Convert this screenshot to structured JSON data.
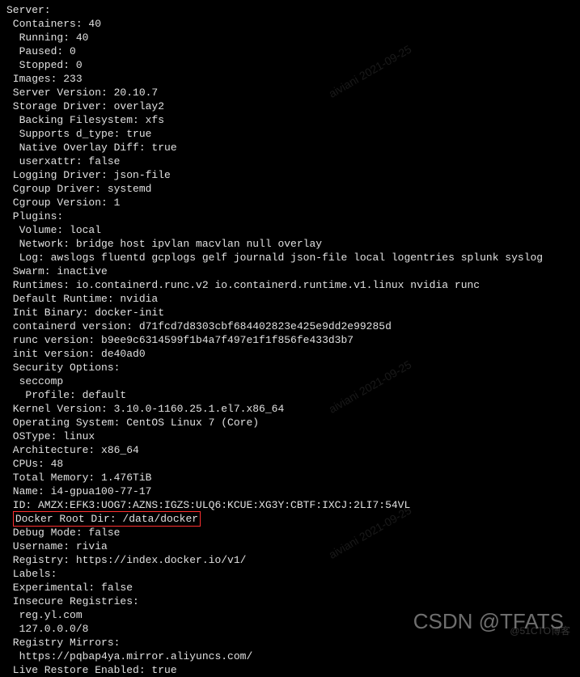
{
  "server_header": "Server:",
  "containers": " Containers: 40",
  "running": "  Running: 40",
  "paused": "  Paused: 0",
  "stopped": "  Stopped: 0",
  "images": " Images: 233",
  "server_version": " Server Version: 20.10.7",
  "storage_driver": " Storage Driver: overlay2",
  "backing_fs": "  Backing Filesystem: xfs",
  "supports_dtype": "  Supports d_type: true",
  "native_overlay": "  Native Overlay Diff: true",
  "userxattr": "  userxattr: false",
  "logging_driver": " Logging Driver: json-file",
  "cgroup_driver": " Cgroup Driver: systemd",
  "cgroup_version": " Cgroup Version: 1",
  "plugins": " Plugins:",
  "volume": "  Volume: local",
  "network": "  Network: bridge host ipvlan macvlan null overlay",
  "log": "  Log: awslogs fluentd gcplogs gelf journald json-file local logentries splunk syslog",
  "swarm": " Swarm: inactive",
  "runtimes": " Runtimes: io.containerd.runc.v2 io.containerd.runtime.v1.linux nvidia runc",
  "default_runtime": " Default Runtime: nvidia",
  "init_binary": " Init Binary: docker-init",
  "containerd_ver": " containerd version: d71fcd7d8303cbf684402823e425e9dd2e99285d",
  "runc_ver": " runc version: b9ee9c6314599f1b4a7f497e1f1f856fe433d3b7",
  "init_ver": " init version: de40ad0",
  "sec_opts": " Security Options:",
  "seccomp": "  seccomp",
  "profile": "   Profile: default",
  "kernel": " Kernel Version: 3.10.0-1160.25.1.el7.x86_64",
  "os": " Operating System: CentOS Linux 7 (Core)",
  "ostype": " OSType: linux",
  "arch": " Architecture: x86_64",
  "cpus": " CPUs: 48",
  "memory": " Total Memory: 1.476TiB",
  "name": " Name: i4-gpua100-77-17",
  "id": " ID: AMZX:EFK3:UOG7:AZNS:IGZS:ULQ6:KCUE:XG3Y:CBTF:IXCJ:2LI7:54VL",
  "docker_root_prefix": " ",
  "docker_root": "Docker Root Dir: /data/docker",
  "debug": " Debug Mode: false",
  "username": " Username: rivia",
  "registry": " Registry: https://index.docker.io/v1/",
  "labels": " Labels:",
  "experimental": " Experimental: false",
  "insecure": " Insecure Registries:",
  "reg1": "  reg.yl.com",
  "reg2": "  127.0.0.0/8",
  "mirrors": " Registry Mirrors:",
  "mirror1": "  https://pqbap4ya.mirror.aliyuncs.com/",
  "live_restore": " Live Restore Enabled: true",
  "watermark_date": "aiviani 2021-09-25",
  "csdn_mark": "CSDN @TFATS",
  "blog_mark": "@51CTO博客"
}
